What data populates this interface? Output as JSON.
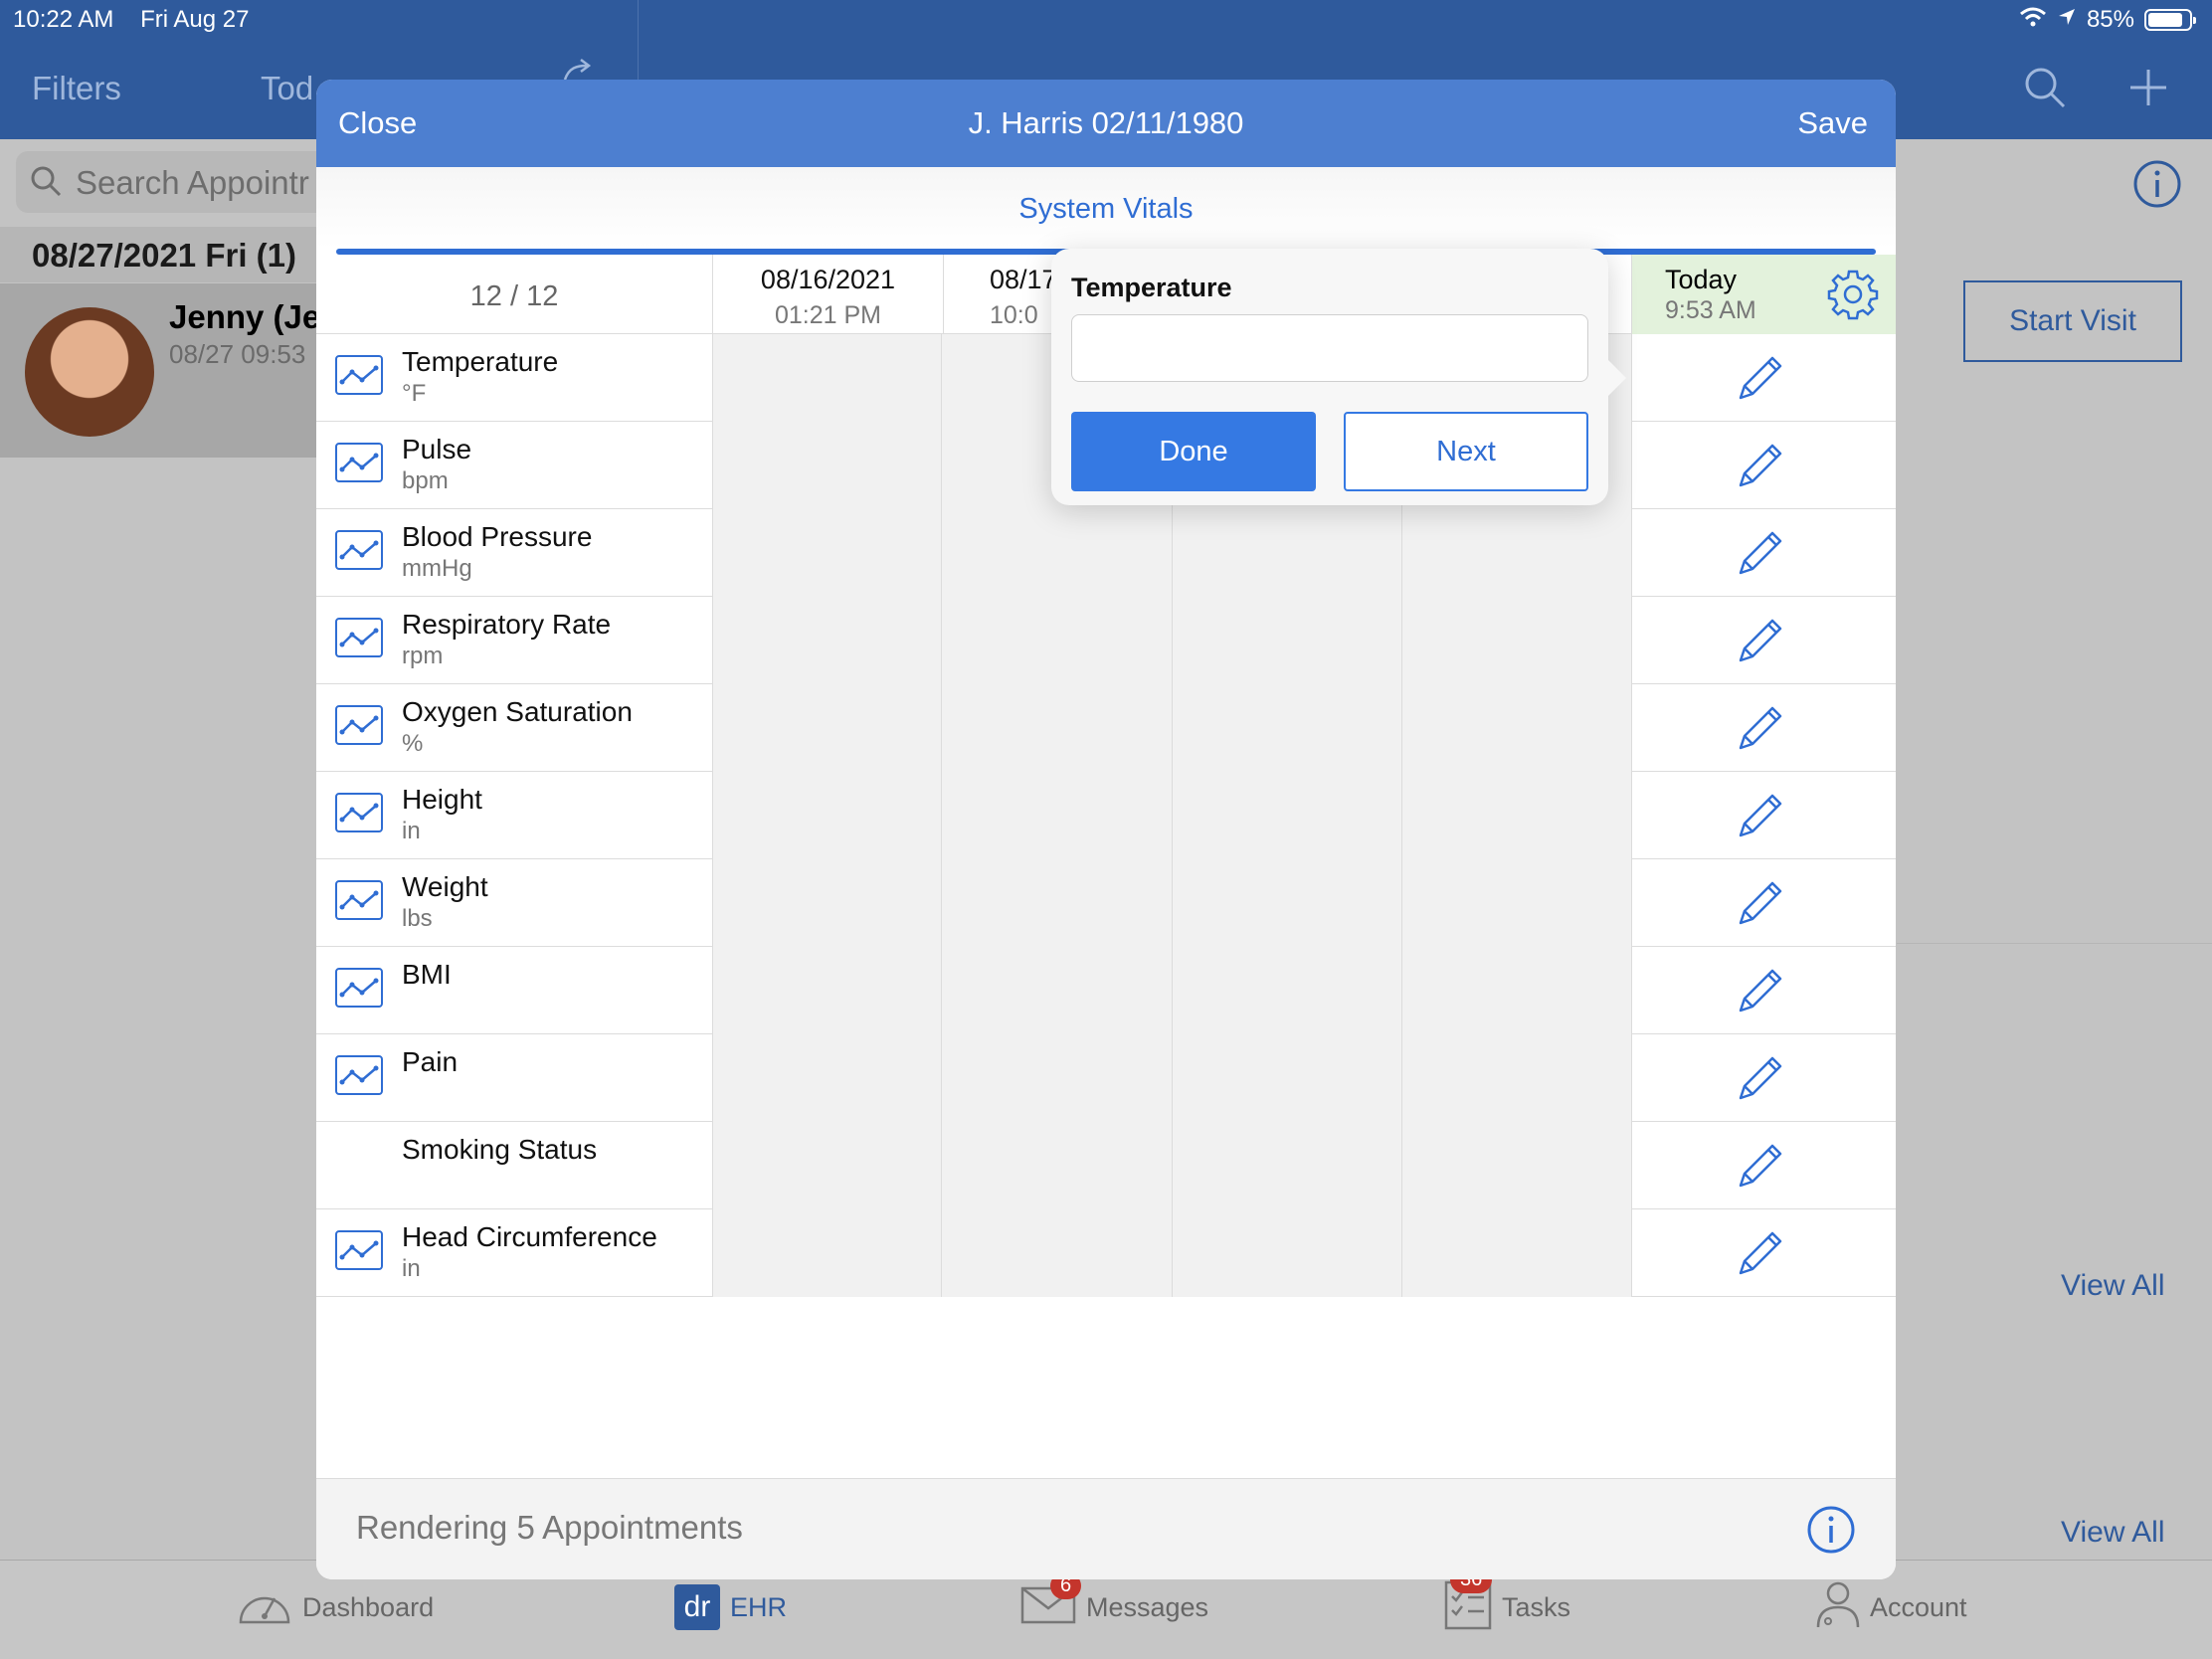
{
  "status_bar": {
    "time": "10:22 AM",
    "date": "Fri Aug 27",
    "battery": "85%",
    "battery_level": 0.85
  },
  "background": {
    "filters_label": "Filters",
    "today_label": "Tod",
    "search_placeholder": "Search Appointr",
    "day_header": "08/27/2021 Fri (1)",
    "appointment": {
      "name": "Jenny (Je",
      "time": "08/27 09:53"
    },
    "start_visit_label": "Start Visit",
    "view_all_1": "View All",
    "view_all_2": "View All"
  },
  "tabbar": {
    "tabs": [
      {
        "label": "Dashboard",
        "icon": "speedometer-icon"
      },
      {
        "label": "EHR",
        "icon": "dr-logo-icon"
      },
      {
        "label": "Messages",
        "icon": "envelope-icon",
        "badge": "6"
      },
      {
        "label": "Tasks",
        "icon": "checklist-icon",
        "badge": "36"
      },
      {
        "label": "Account",
        "icon": "doctor-icon"
      }
    ]
  },
  "modal": {
    "close_label": "Close",
    "title": "J. Harris 02/11/1980",
    "save_label": "Save",
    "subtitle": "System Vitals",
    "count": "12 / 12",
    "columns": [
      {
        "date": "08/16/2021",
        "time": "01:21 PM"
      },
      {
        "date": "08/17",
        "time": "10:0"
      }
    ],
    "today": {
      "date": "Today",
      "time": "9:53 AM"
    },
    "vitals": [
      {
        "label": "Temperature",
        "unit": "°F",
        "chart": true
      },
      {
        "label": "Pulse",
        "unit": "bpm",
        "chart": true
      },
      {
        "label": "Blood Pressure",
        "unit": "mmHg",
        "chart": true
      },
      {
        "label": "Respiratory Rate",
        "unit": "rpm",
        "chart": true
      },
      {
        "label": "Oxygen Saturation",
        "unit": "%",
        "chart": true
      },
      {
        "label": "Height",
        "unit": "in",
        "chart": true
      },
      {
        "label": "Weight",
        "unit": "lbs",
        "chart": true
      },
      {
        "label": "BMI",
        "unit": "",
        "chart": true
      },
      {
        "label": "Pain",
        "unit": "",
        "chart": true
      },
      {
        "label": "Smoking Status",
        "unit": "",
        "chart": false
      },
      {
        "label": "Head Circumference",
        "unit": "in",
        "chart": true
      }
    ],
    "footer_text": "Rendering 5 Appointments"
  },
  "popover": {
    "label": "Temperature",
    "input_value": "",
    "done_label": "Done",
    "next_label": "Next"
  },
  "colors": {
    "nav": "#2f5a9c",
    "modal_header": "#4d7fd0",
    "accent": "#2f6dd3",
    "today_bg": "#e3f2dc",
    "badge": "#c4352c"
  }
}
